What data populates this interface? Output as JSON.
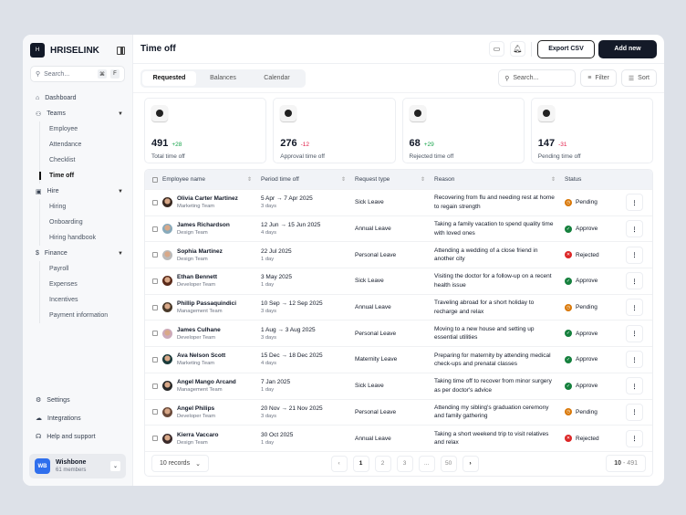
{
  "brand": {
    "name": "HRISELINK",
    "logo_text": "H"
  },
  "sidebar": {
    "search_placeholder": "Search...",
    "kbd": [
      "⌘",
      "F"
    ],
    "dashboard": "Dashboard",
    "groups": [
      {
        "label": "Teams",
        "items": [
          "Employee",
          "Attendance",
          "Checklist",
          "Time off"
        ]
      },
      {
        "label": "Hire",
        "items": [
          "Hiring",
          "Onboarding",
          "Hiring handbook"
        ]
      },
      {
        "label": "Finance",
        "items": [
          "Payroll",
          "Expenses",
          "Incentives",
          "Payment information"
        ]
      }
    ],
    "active_item": "Time off",
    "bottom": [
      "Settings",
      "Integrations",
      "Help and support"
    ],
    "team": {
      "initials": "WB",
      "name": "Wishbone",
      "members": "61 members"
    }
  },
  "header": {
    "title": "Time off",
    "export": "Export CSV",
    "add": "Add new"
  },
  "tabs": [
    "Requested",
    "Balances",
    "Calendar"
  ],
  "toolbar": {
    "search_placeholder": "Search...",
    "filter": "Filter",
    "sort": "Sort"
  },
  "stats": [
    {
      "value": "491",
      "delta": "+28",
      "dir": "up",
      "label": "Total time off"
    },
    {
      "value": "276",
      "delta": "-12",
      "dir": "dn",
      "label": "Approval time off"
    },
    {
      "value": "68",
      "delta": "+29",
      "dir": "up",
      "label": "Rejected time off"
    },
    {
      "value": "147",
      "delta": "-31",
      "dir": "dn",
      "label": "Pending time off"
    }
  ],
  "table": {
    "headers": [
      "Employee name",
      "Period time off",
      "Request type",
      "Reason",
      "Status"
    ],
    "rows": [
      {
        "name": "Olivia Carter Martinez",
        "team": "Marketing Team",
        "period": "5 Apr → 7 Apr 2025",
        "days": "3 days",
        "type": "Sick Leave",
        "reason": "Recovering from flu and needing rest at home to regain strength",
        "status": "Pending"
      },
      {
        "name": "James Richardson",
        "team": "Design Team",
        "period": "12 Jun → 15 Jun 2025",
        "days": "4 days",
        "type": "Annual Leave",
        "reason": "Taking a family vacation to spend quality time with loved ones",
        "status": "Approve"
      },
      {
        "name": "Sophia Martinez",
        "team": "Design Team",
        "period": "22 Jul 2025",
        "days": "1 day",
        "type": "Personal Leave",
        "reason": "Attending a wedding of a close friend in another city",
        "status": "Rejected"
      },
      {
        "name": "Ethan Bennett",
        "team": "Developer Team",
        "period": "3 May 2025",
        "days": "1 day",
        "type": "Sick Leave",
        "reason": "Visiting the doctor for a follow-up on a recent health issue",
        "status": "Approve"
      },
      {
        "name": "Phillip Passaquindici",
        "team": "Management Team",
        "period": "10 Sep → 12 Sep 2025",
        "days": "3 days",
        "type": "Annual Leave",
        "reason": "Traveling abroad for a short holiday to recharge and relax",
        "status": "Pending"
      },
      {
        "name": "James Culhane",
        "team": "Developer Team",
        "period": "1 Aug → 3 Aug 2025",
        "days": "3 days",
        "type": "Personal Leave",
        "reason": "Moving to a new house and setting up essential utilities",
        "status": "Approve"
      },
      {
        "name": "Ava Nelson Scott",
        "team": "Marketing Team",
        "period": "15 Dec → 18 Dec 2025",
        "days": "4 days",
        "type": "Maternity Leave",
        "reason": "Preparing for maternity by attending medical check-ups and prenatal classes",
        "status": "Approve"
      },
      {
        "name": "Angel Mango Arcand",
        "team": "Management Team",
        "period": "7 Jan 2025",
        "days": "1 day",
        "type": "Sick Leave",
        "reason": "Taking time off to recover from minor surgery as per doctor's advice",
        "status": "Approve"
      },
      {
        "name": "Angel Philips",
        "team": "Developer Team",
        "period": "20 Nov → 21 Nov 2025",
        "days": "3 days",
        "type": "Personal Leave",
        "reason": "Attending my sibling's graduation ceremony and family gathering",
        "status": "Pending"
      },
      {
        "name": "Kierra Vaccaro",
        "team": "Design Team",
        "period": "30 Oct 2025",
        "days": "1 day",
        "type": "Annual Leave",
        "reason": "Taking a short weekend trip to visit relatives and relax",
        "status": "Rejected"
      }
    ]
  },
  "status_colors": {
    "Pending": "#d97706",
    "Approve": "#15803d",
    "Rejected": "#dc2626"
  },
  "footer": {
    "records": "10 records",
    "pages": [
      "1",
      "2",
      "3",
      "...",
      "50"
    ],
    "range_start": "10",
    "range_end": "- 491"
  }
}
